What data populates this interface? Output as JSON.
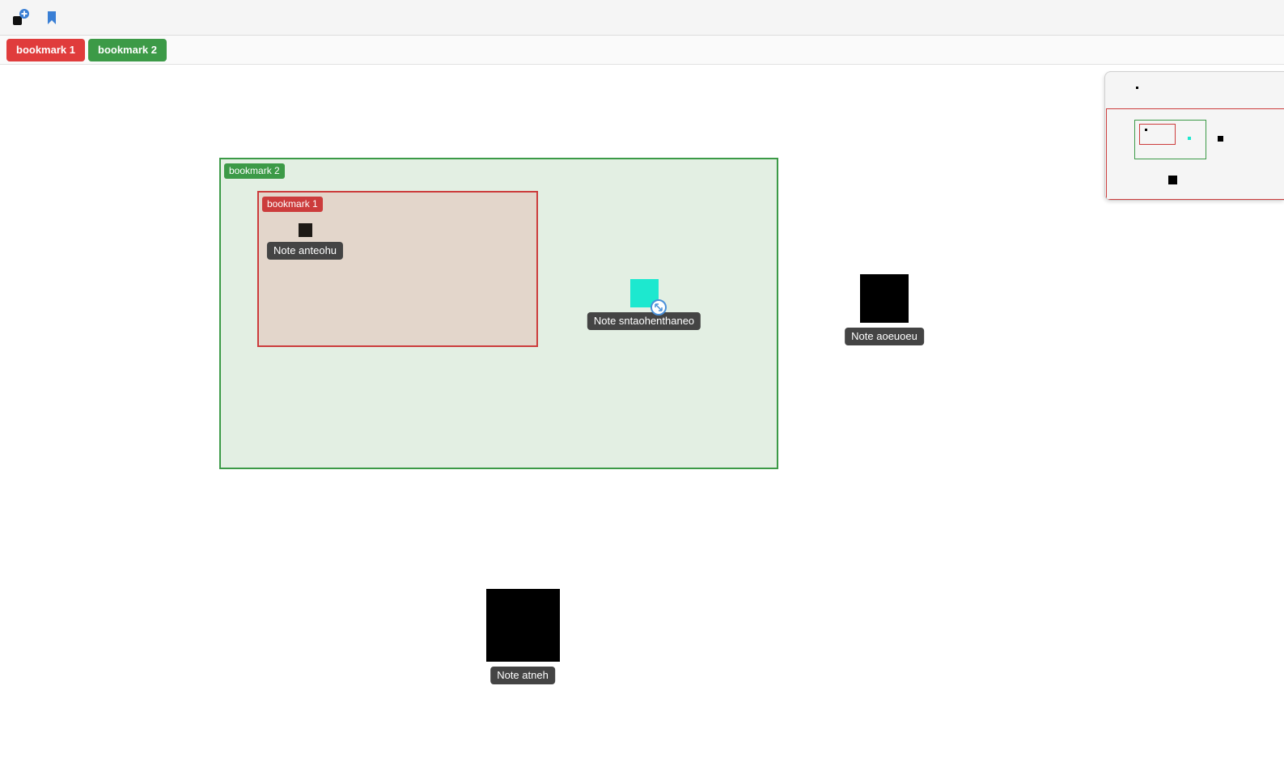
{
  "toolbar": {
    "add_note_icon": "add-note-icon",
    "bookmark_icon": "bookmark-icon"
  },
  "bookmark_bar": {
    "buttons": [
      {
        "label": "bookmark 1",
        "color": "#e03c3c"
      },
      {
        "label": "bookmark 2",
        "color": "#3c9a47"
      }
    ]
  },
  "canvas": {
    "frames": [
      {
        "label": "bookmark 2",
        "border_color": "#3c9a47",
        "fill": "#e3efe3"
      },
      {
        "label": "bookmark 1",
        "border_color": "#cc3c3c",
        "fill": "#e3d6cb"
      }
    ],
    "notes": [
      {
        "label": "Note anteohu",
        "color": "#1e1a16"
      },
      {
        "label": "Note sntaohenthaneo",
        "color": "#1de8cf",
        "selected": true
      },
      {
        "label": "Note aoeuoeu",
        "color": "#000000"
      },
      {
        "label": "Note atneh",
        "color": "#000000"
      }
    ]
  },
  "minimap": {
    "viewport_color": "#cc3c3c",
    "frame_colors": [
      "#3c9a47",
      "#cc3c3c"
    ],
    "note_colors": [
      "#000000",
      "#1de8cf"
    ]
  }
}
